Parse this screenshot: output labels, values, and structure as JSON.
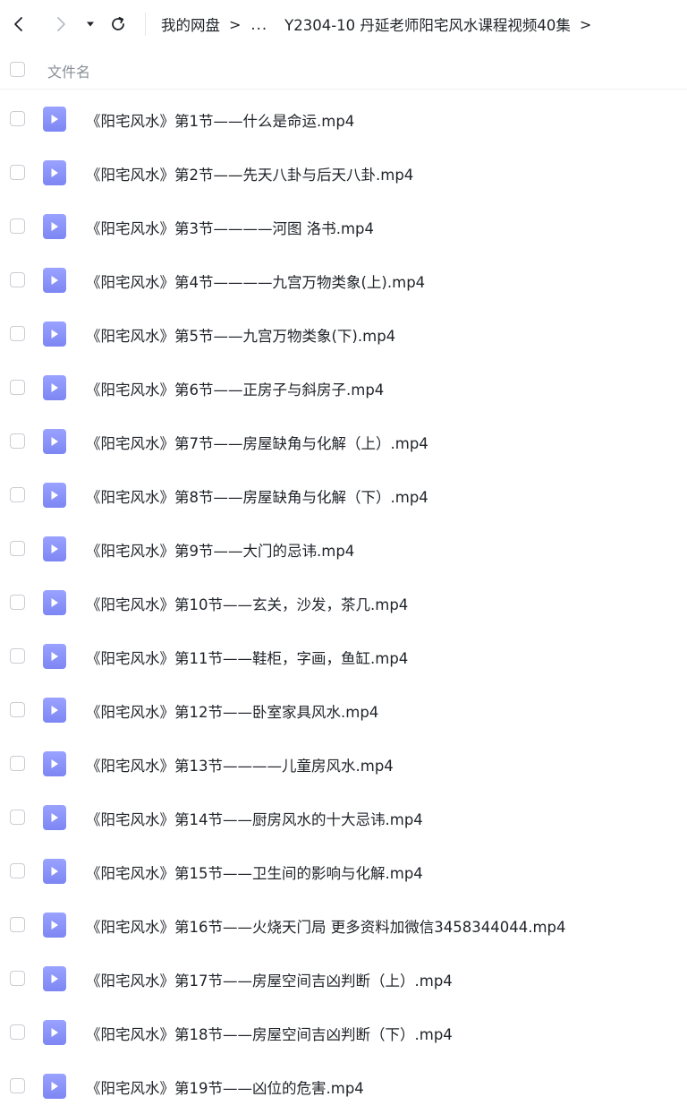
{
  "nav": {
    "back_icon": "chevron-left-icon",
    "forward_icon": "chevron-right-icon",
    "dropdown_icon": "caret-down-icon",
    "refresh_icon": "refresh-icon"
  },
  "breadcrumb": {
    "root": "我的网盘",
    "ellipsis": "...",
    "current": "Y2304-10 丹延老师阳宅风水课程视频40集",
    "separator": ">"
  },
  "list_header": {
    "column_name": "文件名"
  },
  "colors": {
    "icon_top": "#9aa3ff",
    "icon_bottom": "#7d86f3",
    "text": "#1f2329",
    "muted": "#8a8f98"
  },
  "files": [
    {
      "name": "《阳宅风水》第1节——什么是命运.mp4",
      "type_icon": "video-file-icon"
    },
    {
      "name": "《阳宅风水》第2节——先天八卦与后天八卦.mp4",
      "type_icon": "video-file-icon"
    },
    {
      "name": "《阳宅风水》第3节————河图 洛书.mp4",
      "type_icon": "video-file-icon"
    },
    {
      "name": "《阳宅风水》第4节————九宫万物类象(上).mp4",
      "type_icon": "video-file-icon"
    },
    {
      "name": "《阳宅风水》第5节——九宫万物类象(下).mp4",
      "type_icon": "video-file-icon"
    },
    {
      "name": "《阳宅风水》第6节——正房子与斜房子.mp4",
      "type_icon": "video-file-icon"
    },
    {
      "name": "《阳宅风水》第7节——房屋缺角与化解（上）.mp4",
      "type_icon": "video-file-icon"
    },
    {
      "name": "《阳宅风水》第8节——房屋缺角与化解（下）.mp4",
      "type_icon": "video-file-icon"
    },
    {
      "name": "《阳宅风水》第9节——大门的忌讳.mp4",
      "type_icon": "video-file-icon"
    },
    {
      "name": "《阳宅风水》第10节——玄关，沙发，茶几.mp4",
      "type_icon": "video-file-icon"
    },
    {
      "name": "《阳宅风水》第11节——鞋柜，字画，鱼缸.mp4",
      "type_icon": "video-file-icon"
    },
    {
      "name": "《阳宅风水》第12节——卧室家具风水.mp4",
      "type_icon": "video-file-icon"
    },
    {
      "name": "《阳宅风水》第13节————儿童房风水.mp4",
      "type_icon": "video-file-icon"
    },
    {
      "name": "《阳宅风水》第14节——厨房风水的十大忌讳.mp4",
      "type_icon": "video-file-icon"
    },
    {
      "name": "《阳宅风水》第15节——卫生间的影响与化解.mp4",
      "type_icon": "video-file-icon"
    },
    {
      "name": "《阳宅风水》第16节——火烧天门局 更多资料加微信3458344044.mp4",
      "type_icon": "video-file-icon"
    },
    {
      "name": "《阳宅风水》第17节——房屋空间吉凶判断（上）.mp4",
      "type_icon": "video-file-icon"
    },
    {
      "name": "《阳宅风水》第18节——房屋空间吉凶判断（下）.mp4",
      "type_icon": "video-file-icon"
    },
    {
      "name": "《阳宅风水》第19节——凶位的危害.mp4",
      "type_icon": "video-file-icon"
    }
  ]
}
